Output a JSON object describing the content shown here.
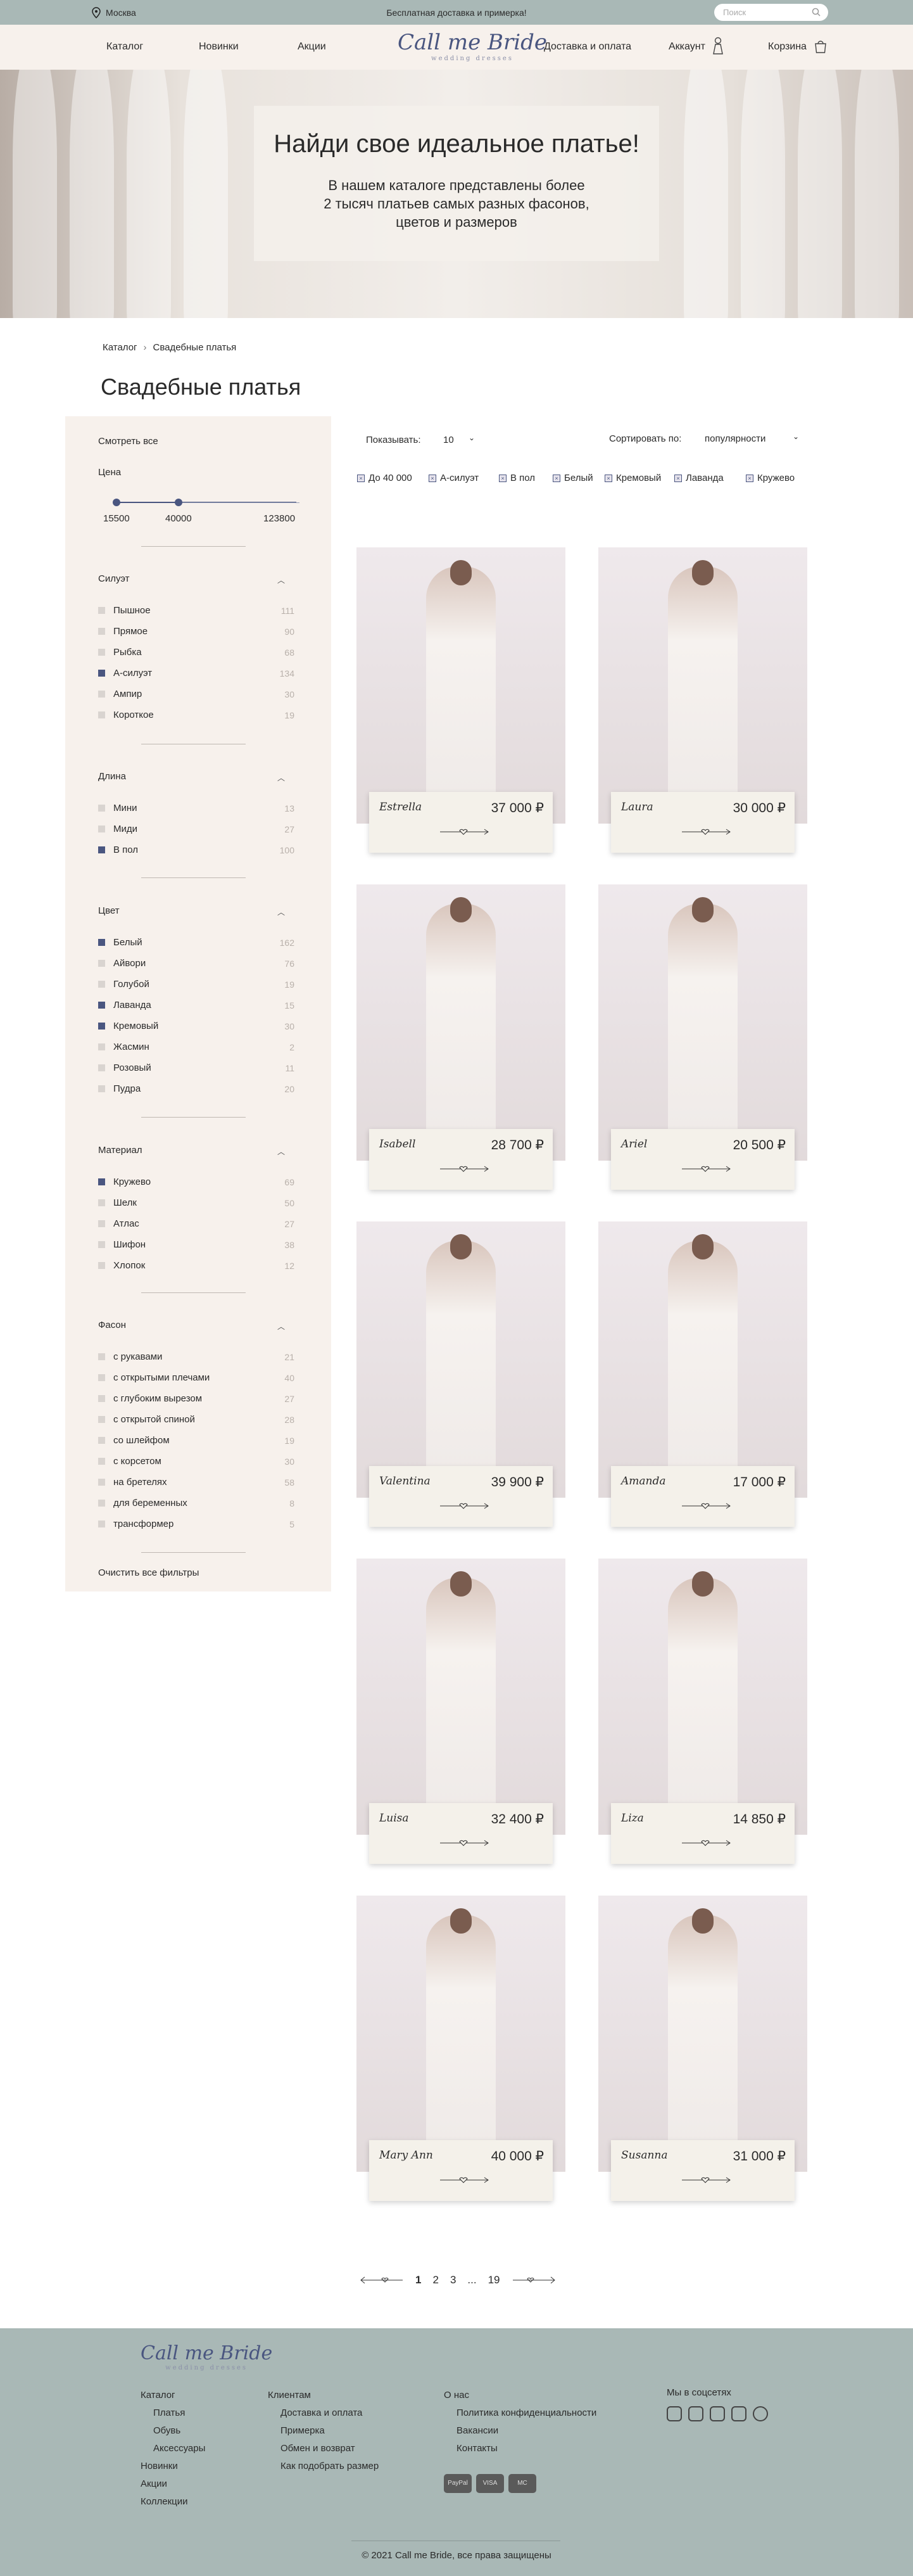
{
  "topbar": {
    "city": "Москва",
    "promo": "Бесплатная доставка и примерка!",
    "search_placeholder": "Поиск"
  },
  "nav": {
    "items": [
      "Каталог",
      "Новинки",
      "Акции",
      "Доставка и оплата",
      "Аккаунт",
      "Корзина"
    ],
    "logo_main": "Call me Bride",
    "logo_sub": "wedding dresses"
  },
  "hero": {
    "title": "Найди свое идеальное платье!",
    "text": "В нашем каталоге представлены более 2 тысяч платьев самых разных фасонов, цветов и размеров"
  },
  "breadcrumb": [
    "Каталог",
    "Свадебные платья"
  ],
  "page_title": "Свадебные платья",
  "sidebar": {
    "view_all": "Смотреть все",
    "price_label": "Цена",
    "price_min": "15500",
    "price_mid": "40000",
    "price_max": "123800",
    "groups": [
      {
        "title": "Силуэт",
        "items": [
          {
            "label": "Пышное",
            "count": "111",
            "on": false
          },
          {
            "label": "Прямое",
            "count": "90",
            "on": false
          },
          {
            "label": "Рыбка",
            "count": "68",
            "on": false
          },
          {
            "label": "А-силуэт",
            "count": "134",
            "on": true
          },
          {
            "label": "Ампир",
            "count": "30",
            "on": false
          },
          {
            "label": "Короткое",
            "count": "19",
            "on": false
          }
        ]
      },
      {
        "title": "Длина",
        "items": [
          {
            "label": "Мини",
            "count": "13",
            "on": false
          },
          {
            "label": "Миди",
            "count": "27",
            "on": false
          },
          {
            "label": "В пол",
            "count": "100",
            "on": true
          }
        ]
      },
      {
        "title": "Цвет",
        "items": [
          {
            "label": "Белый",
            "count": "162",
            "on": true
          },
          {
            "label": "Айвори",
            "count": "76",
            "on": false
          },
          {
            "label": "Голубой",
            "count": "19",
            "on": false
          },
          {
            "label": "Лаванда",
            "count": "15",
            "on": true
          },
          {
            "label": "Кремовый",
            "count": "30",
            "on": true
          },
          {
            "label": "Жасмин",
            "count": "2",
            "on": false
          },
          {
            "label": "Розовый",
            "count": "11",
            "on": false
          },
          {
            "label": "Пудра",
            "count": "20",
            "on": false
          }
        ]
      },
      {
        "title": "Материал",
        "items": [
          {
            "label": "Кружево",
            "count": "69",
            "on": true
          },
          {
            "label": "Шелк",
            "count": "50",
            "on": false
          },
          {
            "label": "Атлас",
            "count": "27",
            "on": false
          },
          {
            "label": "Шифон",
            "count": "38",
            "on": false
          },
          {
            "label": "Хлопок",
            "count": "12",
            "on": false
          }
        ]
      },
      {
        "title": "Фасон",
        "items": [
          {
            "label": "с рукавами",
            "count": "21",
            "on": false
          },
          {
            "label": "с открытыми плечами",
            "count": "40",
            "on": false
          },
          {
            "label": "с глубоким вырезом",
            "count": "27",
            "on": false
          },
          {
            "label": "с открытой спиной",
            "count": "28",
            "on": false
          },
          {
            "label": "со шлейфом",
            "count": "19",
            "on": false
          },
          {
            "label": "с корсетом",
            "count": "30",
            "on": false
          },
          {
            "label": "на бретелях",
            "count": "58",
            "on": false
          },
          {
            "label": "для беременных",
            "count": "8",
            "on": false
          },
          {
            "label": "трансформер",
            "count": "5",
            "on": false
          }
        ]
      }
    ],
    "clear": "Очистить все фильтры"
  },
  "controls": {
    "show_label": "Показывать:",
    "show_value": "10",
    "sort_label": "Сортировать по:",
    "sort_value": "популярности"
  },
  "active_tags": [
    "До 40 000",
    "А-силуэт",
    "В пол",
    "Белый",
    "Кремовый",
    "Лаванда",
    "Кружево"
  ],
  "products": [
    {
      "name": "Estrella",
      "price": "37 000 ₽"
    },
    {
      "name": "Laura",
      "price": "30 000 ₽"
    },
    {
      "name": "Isabell",
      "price": "28 700 ₽"
    },
    {
      "name": "Ariel",
      "price": "20 500 ₽"
    },
    {
      "name": "Valentina",
      "price": "39 900 ₽"
    },
    {
      "name": "Amanda",
      "price": "17 000 ₽"
    },
    {
      "name": "Luisa",
      "price": "32 400 ₽"
    },
    {
      "name": "Lizа",
      "price": "14 850 ₽"
    },
    {
      "name": "Mary Ann",
      "price": "40 000 ₽"
    },
    {
      "name": "Susanna",
      "price": "31 000 ₽"
    }
  ],
  "pagination": [
    "1",
    "2",
    "3",
    "...",
    "19"
  ],
  "footer": {
    "col1": [
      "Каталог",
      "Платья",
      "Обувь",
      "Аксессуары",
      "Новинки",
      "Акции",
      "Коллекции"
    ],
    "col2": [
      "Клиентам",
      "Доставка и оплата",
      "Примерка",
      "Обмен и возврат",
      "Как подобрать размер"
    ],
    "col3": [
      "О нас",
      "Политика конфиденциальности",
      "Вакансии",
      "Контакты"
    ],
    "social_title": "Мы в соцсетях",
    "payments": [
      "PayPal",
      "VISA",
      "MC"
    ],
    "copyright": "© 2021 Call me Bride, все права защищены"
  }
}
